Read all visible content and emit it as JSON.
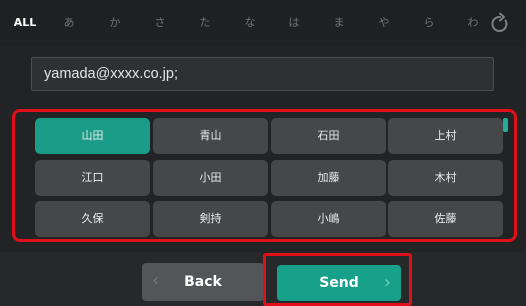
{
  "tabs": [
    {
      "label": "ALL",
      "active": true
    },
    {
      "label": "あ",
      "active": false
    },
    {
      "label": "か",
      "active": false
    },
    {
      "label": "さ",
      "active": false
    },
    {
      "label": "た",
      "active": false
    },
    {
      "label": "な",
      "active": false
    },
    {
      "label": "は",
      "active": false
    },
    {
      "label": "ま",
      "active": false
    },
    {
      "label": "や",
      "active": false
    },
    {
      "label": "ら",
      "active": false
    },
    {
      "label": "わ",
      "active": false
    }
  ],
  "refresh_icon": "refresh-icon",
  "recipient": {
    "value": "yamada@xxxx.co.jp;"
  },
  "contacts": [
    {
      "name": "山田",
      "selected": true
    },
    {
      "name": "青山",
      "selected": false
    },
    {
      "name": "石田",
      "selected": false
    },
    {
      "name": "上村",
      "selected": false
    },
    {
      "name": "江口",
      "selected": false
    },
    {
      "name": "小田",
      "selected": false
    },
    {
      "name": "加藤",
      "selected": false
    },
    {
      "name": "木村",
      "selected": false
    },
    {
      "name": "久保",
      "selected": false
    },
    {
      "name": "剣持",
      "selected": false
    },
    {
      "name": "小嶋",
      "selected": false
    },
    {
      "name": "佐藤",
      "selected": false
    }
  ],
  "footer": {
    "back_label": "Back",
    "send_label": "Send",
    "back_arrow": "‹",
    "send_arrow": "›"
  },
  "colors": {
    "accent": "#1a9c88",
    "highlight_border": "#e0101a",
    "background": "#212325"
  }
}
